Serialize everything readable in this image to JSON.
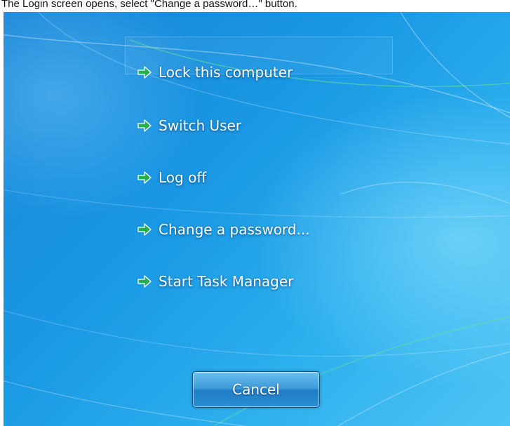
{
  "caption": "The Login screen opens, select \"Change a password…\" button.",
  "options": [
    {
      "label": "Lock this computer",
      "icon": "green-arrow-icon"
    },
    {
      "label": "Switch User",
      "icon": "green-arrow-icon"
    },
    {
      "label": "Log off",
      "icon": "green-arrow-icon"
    },
    {
      "label": "Change a password...",
      "icon": "green-arrow-icon"
    },
    {
      "label": "Start Task Manager",
      "icon": "green-arrow-icon"
    }
  ],
  "cancel_label": "Cancel",
  "colors": {
    "background_blue": "#1a98e4",
    "arrow_green": "#22b14c",
    "text": "#ffffff"
  }
}
